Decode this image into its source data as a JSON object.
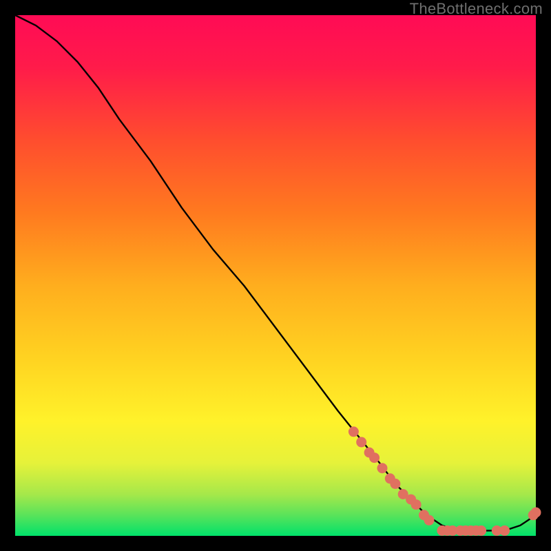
{
  "watermark": "TheBottleneck.com",
  "chart_data": {
    "type": "line",
    "title": "",
    "xlabel": "",
    "ylabel": "",
    "xlim": [
      0,
      100
    ],
    "ylim": [
      0,
      100
    ],
    "grid": false,
    "series": [
      {
        "name": "main-curve",
        "x": [
          0,
          4,
          8,
          12,
          16,
          20,
          26,
          32,
          38,
          44,
          50,
          56,
          62,
          66,
          70,
          73,
          76,
          79,
          82,
          85,
          88,
          91,
          94,
          97,
          100
        ],
        "y": [
          100,
          98,
          95,
          91,
          86,
          80,
          72,
          63,
          55,
          48,
          40,
          32,
          24,
          19,
          14,
          10,
          7,
          4,
          2,
          1,
          1,
          1,
          1,
          2,
          4
        ]
      }
    ],
    "markers": {
      "name": "marker-dots",
      "color": "#e07060",
      "points": [
        {
          "x": 65,
          "y": 20
        },
        {
          "x": 66.5,
          "y": 18
        },
        {
          "x": 68,
          "y": 16
        },
        {
          "x": 69,
          "y": 15
        },
        {
          "x": 70.5,
          "y": 13
        },
        {
          "x": 72,
          "y": 11
        },
        {
          "x": 73,
          "y": 10
        },
        {
          "x": 74.5,
          "y": 8
        },
        {
          "x": 76,
          "y": 7
        },
        {
          "x": 77,
          "y": 6
        },
        {
          "x": 78.5,
          "y": 4
        },
        {
          "x": 79.5,
          "y": 3
        },
        {
          "x": 82,
          "y": 1
        },
        {
          "x": 83,
          "y": 1
        },
        {
          "x": 84,
          "y": 1
        },
        {
          "x": 85.5,
          "y": 1
        },
        {
          "x": 86.5,
          "y": 1
        },
        {
          "x": 87.5,
          "y": 1
        },
        {
          "x": 88.5,
          "y": 1
        },
        {
          "x": 89.5,
          "y": 1
        },
        {
          "x": 92.5,
          "y": 1
        },
        {
          "x": 94,
          "y": 1
        },
        {
          "x": 99.5,
          "y": 4
        },
        {
          "x": 100,
          "y": 4.5
        }
      ]
    }
  }
}
